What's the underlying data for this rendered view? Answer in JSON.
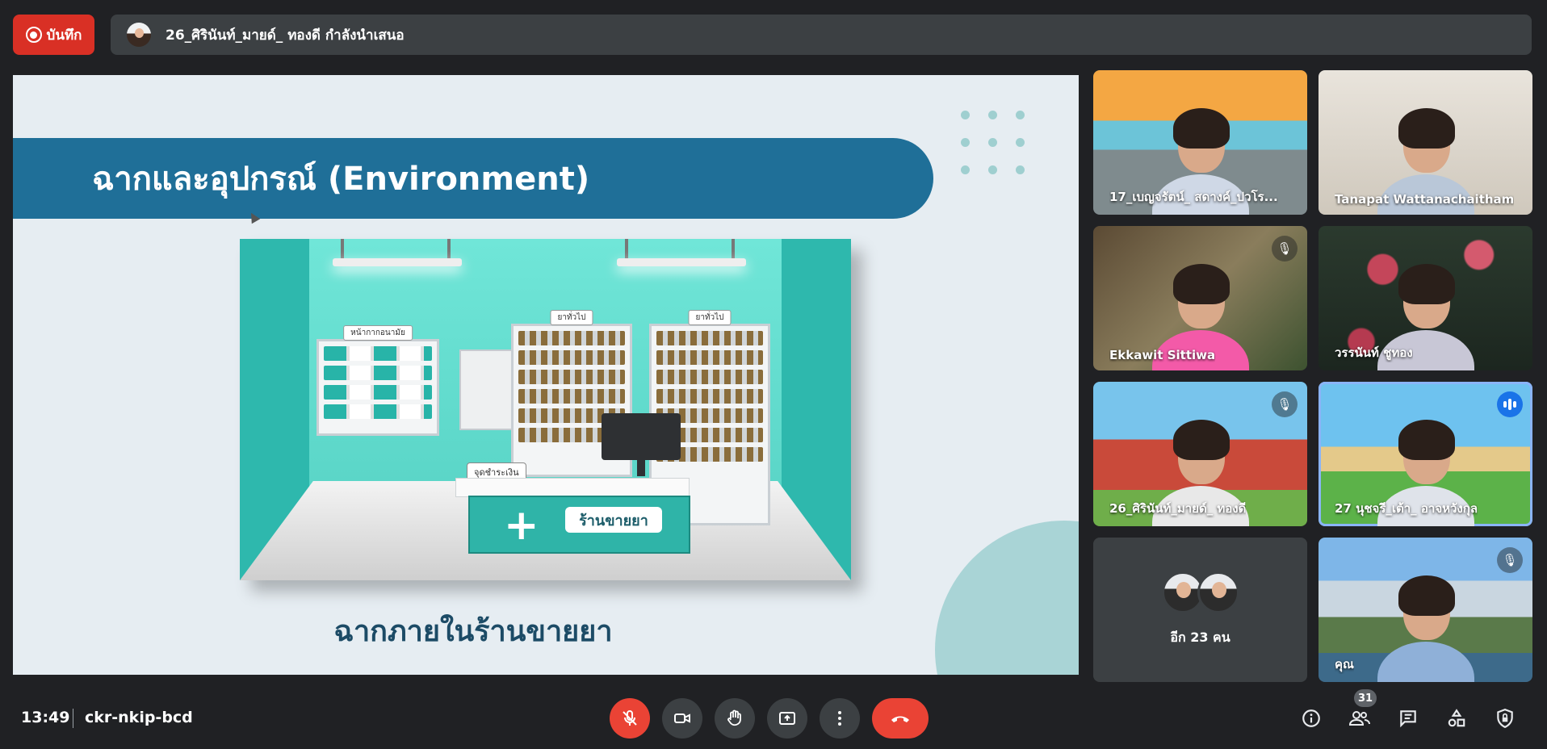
{
  "recording": {
    "label": "บันทึก",
    "icon": "record-icon"
  },
  "presenter": {
    "label": "26_ศิรินันท์_มายด์_ ทองดี กำลังนำเสนอ",
    "avatar": "presenter-avatar"
  },
  "slide": {
    "title": "ฉากและอุปกรณ์ (Environment)",
    "caption": "ฉากภายในร้านขายยา",
    "shelf_tags": [
      "หน้ากากอนามัย",
      "ยาทั่วไป",
      "ยาทั่วไป"
    ],
    "pay_tag": "จุดชำระเงิน",
    "store_sign": "ร้านขายยา"
  },
  "participants": [
    {
      "name": "17_เบญจรัตน์_ สดางค์_ปวโร...",
      "muted": false,
      "speaking": false
    },
    {
      "name": "Tanapat Wattanachaitham",
      "muted": false,
      "speaking": false
    },
    {
      "name": "Ekkawit Sittiwa",
      "muted": true,
      "speaking": false
    },
    {
      "name": "วรรนันท์ ชูทอง",
      "muted": false,
      "speaking": false
    },
    {
      "name": "26_ศิรินันท์_มายด์_ ทองดี",
      "muted": true,
      "speaking": false
    },
    {
      "name": "27 นุชจรี_เต้า_ อาจหวังกุล",
      "muted": false,
      "speaking": true
    },
    {
      "name": "อีก 23 คน",
      "muted": false,
      "speaking": false
    },
    {
      "name": "คุณ",
      "muted": true,
      "speaking": false
    }
  ],
  "meeting": {
    "time": "13:49",
    "code": "ckr-nkip-bcd",
    "participant_count": "31"
  },
  "controls": {
    "mic": "mic-off-icon",
    "camera": "camera-icon",
    "raise_hand": "hand-icon",
    "present": "present-icon",
    "more": "more-vert-icon",
    "hangup": "phone-hangup-icon"
  },
  "side_actions": [
    "info-icon",
    "people-icon",
    "chat-icon",
    "activities-icon",
    "host-controls-icon"
  ],
  "colors": {
    "recording": "#d93025",
    "hangup": "#ea4335",
    "speaking": "#1a73e8",
    "slide_banner": "#1f6f98"
  }
}
